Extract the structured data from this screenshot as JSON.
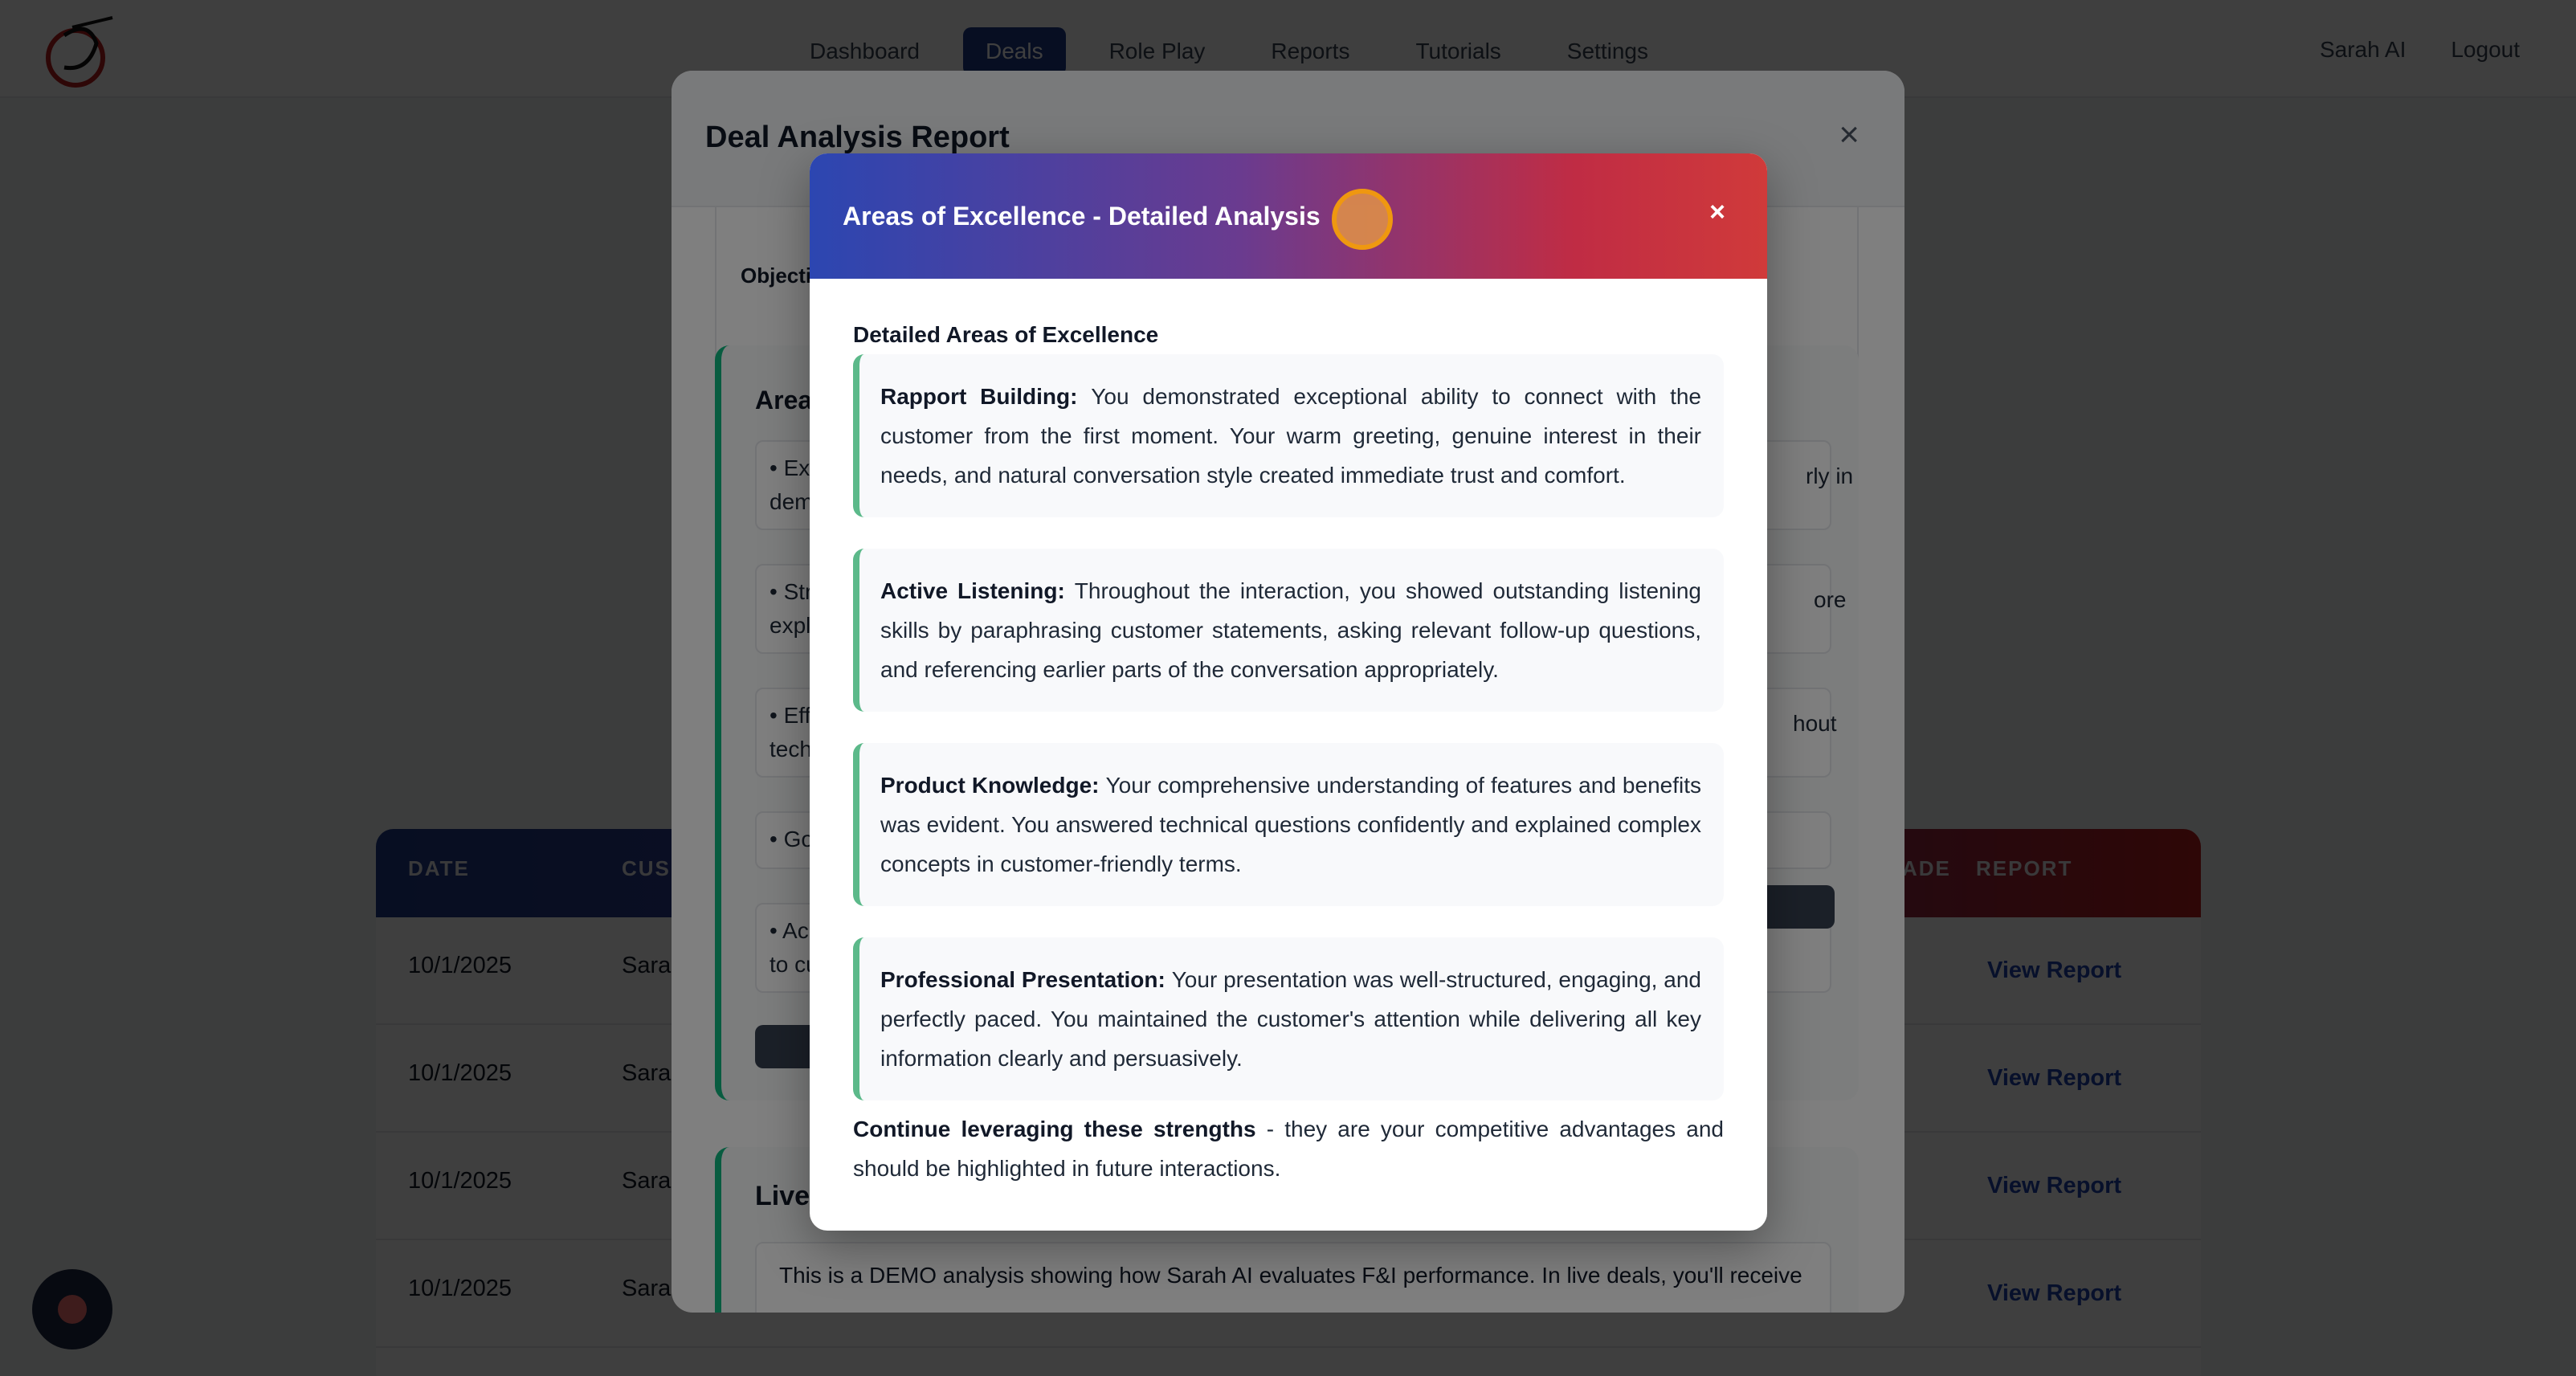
{
  "nav": {
    "links": [
      "Dashboard",
      "Deals",
      "Role Play",
      "Reports",
      "Tutorials",
      "Settings"
    ],
    "active": "Deals",
    "user": "Sarah AI",
    "logout": "Logout"
  },
  "table": {
    "headers": {
      "date": "DATE",
      "customer": "CUS",
      "grade": "ADE",
      "report": "REPORT"
    },
    "rows": [
      {
        "date": "10/1/2025",
        "customer": "Sarah",
        "action": "View Report"
      },
      {
        "date": "10/1/2025",
        "customer": "Sarah",
        "action": "View Report"
      },
      {
        "date": "10/1/2025",
        "customer": "Sarah",
        "action": "View Report"
      },
      {
        "date": "10/1/2025",
        "customer": "Sarah",
        "action": "View Report"
      }
    ]
  },
  "deal_modal": {
    "title": "Deal Analysis Report",
    "close": "×",
    "objection_label": "Objecti",
    "areas_title": "Area",
    "bullets_left": [
      "• Exc",
      "dem",
      "• Str",
      "expl",
      "• Eff",
      "tech",
      "• Go",
      "• Ac",
      "to cu"
    ],
    "bullets_right": [
      "rly in",
      "ore",
      "hout"
    ],
    "live_title": "Live",
    "live_text": "This is a DEMO analysis showing how Sarah AI evaluates F&I performance. In live deals, you'll receive"
  },
  "excellence_modal": {
    "title": "Areas of Excellence - Detailed Analysis",
    "close": "×",
    "heading": "Detailed Areas of Excellence",
    "items": [
      {
        "label": "Rapport Building:",
        "text": "You demonstrated exceptional ability to connect with the customer from the first moment. Your warm greeting, genuine interest in their needs, and natural conversation style created immediate trust and comfort."
      },
      {
        "label": "Active Listening:",
        "text": "Throughout the interaction, you showed outstanding listening skills by paraphrasing customer statements, asking relevant follow-up questions, and referencing earlier parts of the conversation appropriately."
      },
      {
        "label": "Product Knowledge:",
        "text": "Your comprehensive understanding of features and benefits was evident. You answered technical questions confidently and explained complex concepts in customer-friendly terms."
      },
      {
        "label": "Professional Presentation:",
        "text": "Your presentation was well-structured, engaging, and perfectly paced. You maintained the customer's attention while delivering all key information clearly and persuasively."
      }
    ],
    "closing_bold": "Continue leveraging these strengths",
    "closing_text": " - they are your competitive advantages and should be highlighted in future interactions."
  },
  "colors": {
    "nav_active": "#1e3a8a",
    "header_gradient_start": "#2c46b1",
    "header_gradient_end": "#d03a3a",
    "accent_green": "#5cb98a",
    "link_blue": "#1e40af"
  }
}
